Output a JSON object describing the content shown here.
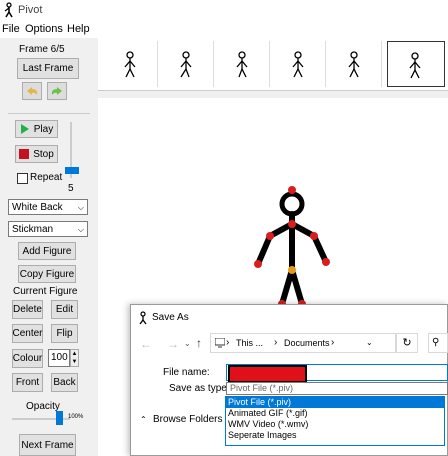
{
  "app": {
    "title": "Pivot"
  },
  "menu": {
    "file": "File",
    "options": "Options",
    "help": "Help"
  },
  "left": {
    "frame_counter": "Frame 6/5",
    "last_frame": "Last Frame",
    "play": "Play",
    "stop": "Stop",
    "repeat": "Repeat",
    "speed_value": "5",
    "background_select": "White Back",
    "figure_type_select": "Stickman",
    "add_figure": "Add Figure",
    "copy_figure": "Copy Figure",
    "current_figure": "Current Figure",
    "delete": "Delete",
    "edit": "Edit",
    "center": "Center",
    "flip": "Flip",
    "colour": "Colour",
    "colour_value": "100",
    "front": "Front",
    "back": "Back",
    "opacity": "Opacity",
    "opacity_value": "100%",
    "next_frame": "Next Frame"
  },
  "dialog": {
    "title": "Save As",
    "breadcrumb_1": "This ...",
    "breadcrumb_sep": "›",
    "breadcrumb_2": "Documents",
    "file_name_label": "File name:",
    "save_as_type_label": "Save as type:",
    "save_as_type_value": "Pivot File (*.piv)",
    "browse_folders": "Browse Folders",
    "options": [
      "Pivot File (*.piv)",
      "Animated GIF (*.gif)",
      "WMV Video (*.wmv)",
      "Seperate Images"
    ],
    "selected_index": 0
  },
  "colors": {
    "accent": "#0078d7",
    "play_green": "#21b14b",
    "stop_red": "#c8101e",
    "joint_red": "#d81e1e",
    "redaction": "#e0101a"
  }
}
